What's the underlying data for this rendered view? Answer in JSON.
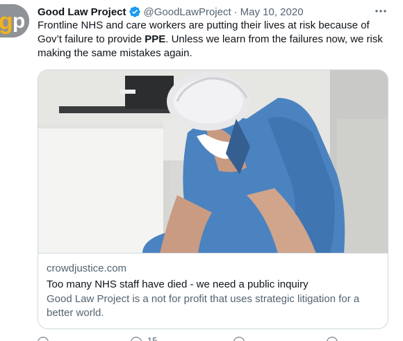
{
  "tweet": {
    "author_name": "Good Law Project",
    "handle": "@GoodLawProject",
    "separator": "·",
    "date": "May 10, 2020",
    "text_before": "Frontline NHS and care workers are putting their lives at risk because of Gov’t failure to provide ",
    "text_bold": "PPE",
    "text_after": ". Unless we learn from the failures now, we risk making the same mistakes again."
  },
  "card": {
    "domain": "crowdjustice.com",
    "title": "Too many NHS staff have died - we need a public inquiry",
    "description": "Good Law Project is a not for profit that uses strategic litigation for a better world."
  },
  "actions": {
    "reply_count": "",
    "retweet_count": "15",
    "like_count": "",
    "share_count": ""
  },
  "icons": {
    "verified": "verified-badge-icon",
    "more": "more-horizontal-icon"
  },
  "colors": {
    "verified_blue": "#1d9bf0",
    "secondary_text": "#536471",
    "border": "#cfd9de",
    "scrub_blue": "#4b83c0"
  }
}
